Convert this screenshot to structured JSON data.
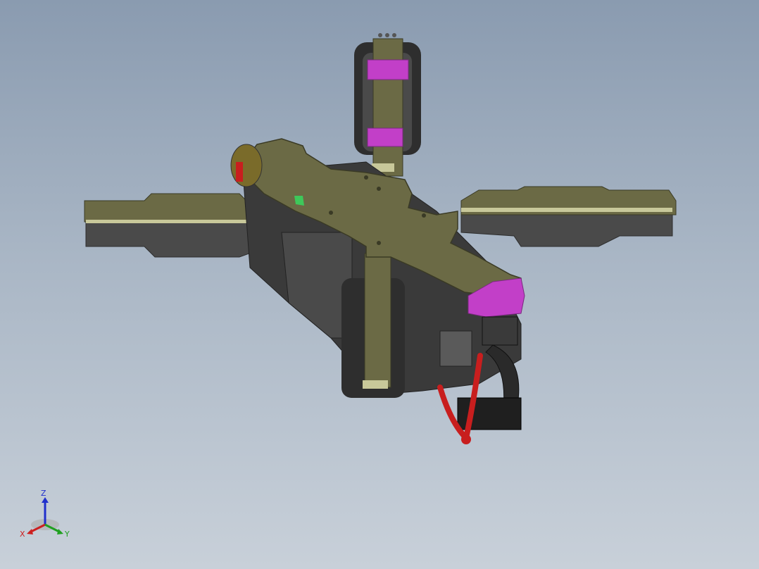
{
  "viewport": {
    "background_top": "#8a9bb0",
    "background_bottom": "#c8d0d9"
  },
  "model": {
    "frame_color": "#6b6a45",
    "frame_edge": "#3a3a25",
    "arm_edge_color": "#c8c89a",
    "motor_color": "#4a4a4a",
    "motor_dark": "#2e2e2e",
    "accent_magenta": "#c23fc8",
    "accent_magenta_dark": "#7a2a7f",
    "wire_red": "#c81e1e",
    "accent_green": "#3ec85a"
  },
  "triad": {
    "z_label": "Z",
    "x_label": "X",
    "y_label": "Y",
    "x_color": "#cc2020",
    "y_color": "#20a020",
    "z_color": "#2030cc"
  }
}
